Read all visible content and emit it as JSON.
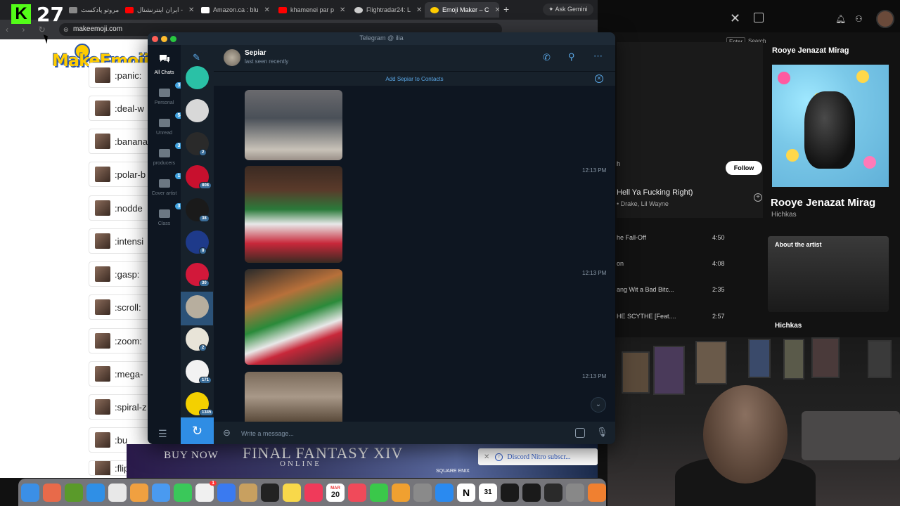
{
  "overlay": {
    "kick_logo": "K",
    "kick_count": "27"
  },
  "browser": {
    "tabs": [
      {
        "label": "مروتو پادکست",
        "favicon_color": "#888888"
      },
      {
        "label": "ایران اینترنشنال -",
        "favicon_color": "#ff0000"
      },
      {
        "label": "Amazon.ca : blu",
        "favicon_color": "#ffffff"
      },
      {
        "label": "khamenei par p",
        "favicon_color": "#ff0000"
      },
      {
        "label": "Flightradar24: L",
        "favicon_color": "#cccccc"
      },
      {
        "label": "Emoji Maker – C",
        "favicon_color": "#ffcc00"
      }
    ],
    "gemini_label": "Ask Gemini",
    "url": "makeemoji.com"
  },
  "makeemoji": {
    "logo": "MakeEmoji",
    "emojis": [
      ":panic:",
      ":deal-w",
      ":banana",
      ":polar-b",
      ":nodde",
      ":intensi",
      ":gasp:",
      ":scroll:",
      ":zoom:",
      ":mega-",
      ":spiral-z",
      ":bu",
      ":flip"
    ]
  },
  "ad": {
    "buy_now": "BUY NOW",
    "title": "FINAL FANTASY XIV",
    "subtitle": "ONLINE",
    "publisher": "SQUARE ENIX",
    "discord_toast": "Discord Nitro subscr..."
  },
  "spotify": {
    "enter_key": "Enter",
    "search_label": "Search",
    "follow_label": "Follow",
    "partial_label": "h",
    "current_song": "Hell Ya Fucking Right)",
    "current_artists": "• Drake, Lil Wayne",
    "tracks": [
      {
        "title": "he Fall-Off",
        "duration": "4:50"
      },
      {
        "title": "on",
        "duration": "4:08"
      },
      {
        "title": "ang Wit a Bad Bitc...",
        "duration": "2:35"
      },
      {
        "title": "HE SCYTHE [Feat....",
        "duration": "2:57"
      }
    ],
    "album_title_small": "Rooye Jenazat Mirag",
    "album_title": "Rooye Jenazat Mirag",
    "artist": "Hichkas",
    "about_label": "About the artist",
    "artist_name": "Hichkas"
  },
  "telegram": {
    "window_title": "Telegram @ ilia",
    "folders": [
      {
        "label": "All Chats",
        "badge": ""
      },
      {
        "label": "Personal",
        "badge": "395"
      },
      {
        "label": "Unread",
        "badge": "543"
      },
      {
        "label": "producers",
        "badge": "3"
      },
      {
        "label": "Cover artist",
        "badge": "1"
      },
      {
        "label": "Class",
        "badge": "3"
      }
    ],
    "chats": [
      {
        "color": "#2ac1a6",
        "badge": ""
      },
      {
        "color": "#d8d8d8",
        "badge": ""
      },
      {
        "color": "#2a2a2a",
        "badge": "2"
      },
      {
        "color": "#c8102e",
        "badge": "808"
      },
      {
        "color": "#1a1a1a",
        "badge": "38"
      },
      {
        "color": "#1e3a8a",
        "badge": "8"
      },
      {
        "color": "#d2183a",
        "badge": "30"
      },
      {
        "color": "#b7ae9e",
        "badge": ""
      },
      {
        "color": "#e8e4d8",
        "badge": "2"
      },
      {
        "color": "#f2f2f2",
        "badge": "171"
      },
      {
        "color": "#f4d000",
        "badge": "1345"
      }
    ],
    "peer_name": "Sepiar",
    "peer_status": "last seen recently",
    "add_contact": "Add Sepiar to Contacts",
    "message_times": [
      "12:13 PM",
      "12:13 PM",
      "12:13 PM"
    ],
    "input_placeholder": "Write a message..."
  },
  "dock": {
    "apps": [
      {
        "name": "finder-icon",
        "color": "#3b8fe6"
      },
      {
        "name": "launchpad-icon",
        "color": "#e86a4a"
      },
      {
        "name": "app-icon",
        "color": "#5a9a2a"
      },
      {
        "name": "safari-icon",
        "color": "#2f8fe6"
      },
      {
        "name": "chrome-icon",
        "color": "#e8e8e8"
      },
      {
        "name": "photos-icon",
        "color": "#f0a040"
      },
      {
        "name": "mail-icon",
        "color": "#4a9af0"
      },
      {
        "name": "facetime-icon",
        "color": "#3ac85a"
      },
      {
        "name": "reminders-icon",
        "color": "#f0f0f0"
      },
      {
        "name": "freeform-icon",
        "color": "#3a7af0"
      },
      {
        "name": "app-icon",
        "color": "#c8a060"
      },
      {
        "name": "apple-tv-icon",
        "color": "#222222"
      },
      {
        "name": "notes-icon",
        "color": "#f8d84a"
      },
      {
        "name": "music-icon",
        "color": "#f03a5a"
      },
      {
        "name": "calendar-icon",
        "color": "#ffffff"
      },
      {
        "name": "news-icon",
        "color": "#f04a5a"
      },
      {
        "name": "numbers-icon",
        "color": "#3ac84a"
      },
      {
        "name": "pages-icon",
        "color": "#f0a030"
      },
      {
        "name": "system-settings-icon",
        "color": "#8a8a8a"
      },
      {
        "name": "app-store-icon",
        "color": "#2a8af0"
      },
      {
        "name": "notion-icon",
        "color": "#ffffff"
      },
      {
        "name": "calendar-31-icon",
        "color": "#ffffff"
      },
      {
        "name": "app-icon",
        "color": "#1a1a1a"
      },
      {
        "name": "app-icon",
        "color": "#1a1a1a"
      },
      {
        "name": "app-icon",
        "color": "#2a2a2a"
      },
      {
        "name": "app-icon",
        "color": "#888888"
      },
      {
        "name": "app-icon",
        "color": "#f08030"
      }
    ],
    "calendar_month": "MAR",
    "calendar_day": "20",
    "badge": "1",
    "day31": "31",
    "notion_letter": "N"
  }
}
